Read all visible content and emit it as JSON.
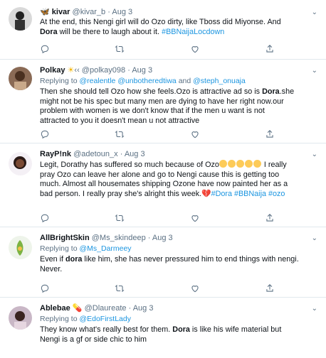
{
  "tweets": [
    {
      "name": "kivar",
      "handle": "@kivar_b",
      "sep": "·",
      "date": "Aug 3",
      "name_icon": "butterfly-emoji",
      "text_a": "At the end, this Nengi girl will do Ozo dirty, like Tboss did Miyonse. And",
      "text_b_bold": "Dora",
      "text_b": " will be there to laugh about it. ",
      "hashtag": "#BBNaijaLocdown"
    },
    {
      "name": "Polkay",
      "name_suffix": "☀ ‹‹",
      "handle": "@polkay098",
      "sep": "·",
      "date": "Aug 3",
      "replying_label": "Replying to ",
      "reply_1": "@realentle",
      "reply_2": "@unbotheredtiwa",
      "reply_and": " and ",
      "reply_3": "@steph_onuaja",
      "line1_a": "Then she should tell Ozo how she feels.Ozo is attractive ad so is ",
      "line1_bold": "Dora",
      "line1_b": ".she",
      "line2": "might not be his spec but many men are dying to have her right now.our",
      "line3": "problem with women is we don't know that if the men u want is not",
      "line4": "attracted to you it doesn't mean u not attractive"
    },
    {
      "name": "RayP!nk",
      "handle": "@adetoun_x",
      "sep": "·",
      "date": "Aug 3",
      "line1": "Legit, Dorathy has suffered so much because of Ozo",
      "line1_end": " I really",
      "line2": "pray Ozo can leave her alone and go to Nengi cause this is getting too",
      "line3": "much. Almost all housemates shipping Ozone have now painted her as a",
      "line4": "bad person. I really pray she's alright this week.",
      "tags": "#Dora #BBNaija #ozo",
      "emojis": [
        "crying-face",
        "crying-face",
        "crying-face",
        "crying-face",
        "crying-face"
      ],
      "broken_heart": "broken-heart-emoji"
    },
    {
      "name": "AllBrightSkin",
      "handle": "@Ms_skindeep",
      "sep": "·",
      "date": "Aug 3",
      "replying_label": "Replying to ",
      "reply_1": "@Ms_Darmeey",
      "line1_a": "Even if ",
      "line1_bold": "dora",
      "line1_b": " like him, she has never pressured him to end things with nengi.",
      "line2": "Never."
    },
    {
      "name": "Ablebae",
      "name_icon": "pill-emoji",
      "handle": "@Dlaureate",
      "sep": "·",
      "date": "Aug 3",
      "replying_label": "Replying to ",
      "reply_1": "@EdoFirstLady",
      "line1_a": "They know what's really best for them. ",
      "line1_bold": "Dora",
      "line1_b": " is like his wife material but",
      "line2": "Nengi is a gf or side chic to him"
    }
  ],
  "actions": [
    "reply-icon",
    "retweet-icon",
    "like-icon",
    "share-icon"
  ],
  "colors": {
    "link": "#1b95e0",
    "muted": "#5b7083",
    "divider": "#e1e8ed"
  }
}
